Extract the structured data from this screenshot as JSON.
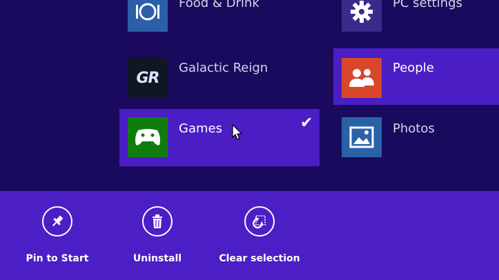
{
  "apps": {
    "food": {
      "label": "Food & Drink",
      "icon": "food-drink-icon",
      "color": "#2c5fa8"
    },
    "pcsettings": {
      "label": "PC settings",
      "icon": "gear-icon",
      "color": "#3a2a8a"
    },
    "galactic": {
      "label": "Galactic Reign",
      "icon": "galactic-reign-logo-icon",
      "logo_text": "GR",
      "color": "#101624"
    },
    "people": {
      "label": "People",
      "icon": "people-icon",
      "color": "#d9462a"
    },
    "games": {
      "label": "Games",
      "icon": "xbox-controller-icon",
      "color": "#107c10",
      "selected": true
    },
    "photos": {
      "label": "Photos",
      "icon": "photos-icon",
      "color": "#2a62a8"
    }
  },
  "appbar": {
    "pin": {
      "label": "Pin to Start",
      "icon": "pin-icon"
    },
    "uninstall": {
      "label": "Uninstall",
      "icon": "trash-icon"
    },
    "clear": {
      "label": "Clear selection",
      "icon": "clear-selection-icon"
    }
  },
  "colors": {
    "background": "#1a0a5e",
    "accent": "#4a1ec4",
    "appbar": "#4b1fc5"
  }
}
